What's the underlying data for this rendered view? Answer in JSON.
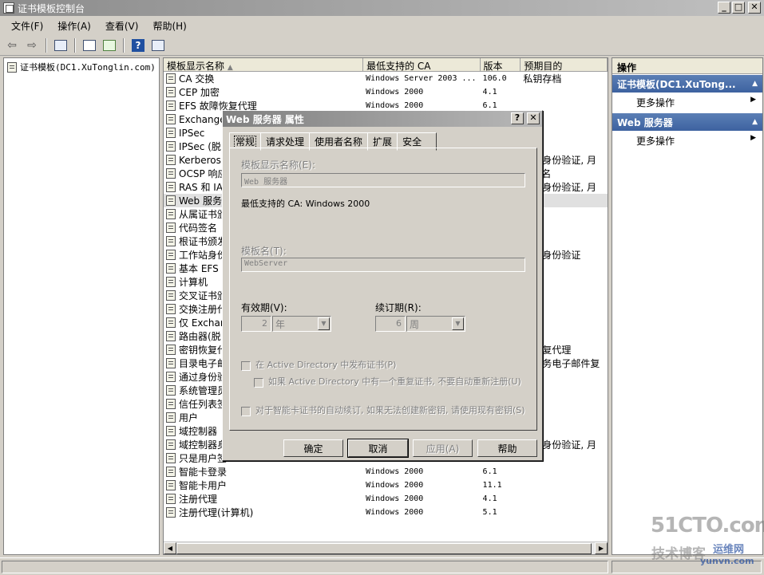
{
  "window": {
    "title": "证书模板控制台"
  },
  "menu": [
    "文件(F)",
    "操作(A)",
    "查看(V)",
    "帮助(H)"
  ],
  "tree": {
    "root": "证书模板(DC1.XuTonglin.com)"
  },
  "list": {
    "headers": {
      "name": "模板显示名称",
      "ca": "最低支持的 CA",
      "version": "版本",
      "purpose": "预期目的"
    },
    "rows": [
      {
        "name": "CA 交换",
        "ca": "Windows Server 2003 ...",
        "version": "106.0",
        "purpose": "私钥存档"
      },
      {
        "name": "CEP 加密",
        "ca": "Windows 2000",
        "version": "4.1",
        "purpose": ""
      },
      {
        "name": "EFS 故障恢复代理",
        "ca": "Windows 2000",
        "version": "6.1",
        "purpose": ""
      },
      {
        "name": "Exchange",
        "ca": "",
        "version": "",
        "purpose": ""
      },
      {
        "name": "IPSec",
        "ca": "",
        "version": "",
        "purpose": ""
      },
      {
        "name": "IPSec (脱",
        "ca": "",
        "version": "",
        "purpose": ""
      },
      {
        "name": "Kerberos",
        "ca": "",
        "version": "",
        "purpose": "户端身份验证, 月"
      },
      {
        "name": "OCSP 响应",
        "ca": "",
        "version": "",
        "purpose": "P 签名"
      },
      {
        "name": "RAS 和 IA",
        "ca": "",
        "version": "",
        "purpose": "户端身份验证, 月"
      },
      {
        "name": "Web 服务器",
        "ca": "",
        "version": "",
        "purpose": "",
        "selected": true
      },
      {
        "name": "从属证书颁",
        "ca": "",
        "version": "",
        "purpose": ""
      },
      {
        "name": "代码签名",
        "ca": "",
        "version": "",
        "purpose": ""
      },
      {
        "name": "根证书颁发",
        "ca": "",
        "version": "",
        "purpose": ""
      },
      {
        "name": "工作站身份",
        "ca": "",
        "version": "",
        "purpose": "户端身份验证"
      },
      {
        "name": "基本 EFS",
        "ca": "",
        "version": "",
        "purpose": ""
      },
      {
        "name": "计算机",
        "ca": "",
        "version": "",
        "purpose": ""
      },
      {
        "name": "交叉证书颁",
        "ca": "",
        "version": "",
        "purpose": ""
      },
      {
        "name": "交换注册代",
        "ca": "",
        "version": "",
        "purpose": ""
      },
      {
        "name": "仅 Exchan",
        "ca": "",
        "version": "",
        "purpose": ""
      },
      {
        "name": "路由器(脱",
        "ca": "",
        "version": "",
        "purpose": ""
      },
      {
        "name": "密钥恢复代",
        "ca": "",
        "version": "",
        "purpose": "钥恢复代理"
      },
      {
        "name": "目录电子邮",
        "ca": "",
        "version": "",
        "purpose": "录服务电子邮件复"
      },
      {
        "name": "通过身份验",
        "ca": "",
        "version": "",
        "purpose": ""
      },
      {
        "name": "系统管理员",
        "ca": "",
        "version": "",
        "purpose": ""
      },
      {
        "name": "信任列表签",
        "ca": "",
        "version": "",
        "purpose": ""
      },
      {
        "name": "用户",
        "ca": "",
        "version": "",
        "purpose": ""
      },
      {
        "name": "域控制器",
        "ca": "",
        "version": "",
        "purpose": ""
      },
      {
        "name": "域控制器身",
        "ca": "",
        "version": "",
        "purpose": "户端身份验证, 月"
      },
      {
        "name": "只是用户签",
        "ca": "",
        "version": "",
        "purpose": ""
      },
      {
        "name": "智能卡登录",
        "ca": "Windows 2000",
        "version": "6.1",
        "purpose": ""
      },
      {
        "name": "智能卡用户",
        "ca": "Windows 2000",
        "version": "11.1",
        "purpose": ""
      },
      {
        "name": "注册代理",
        "ca": "Windows 2000",
        "version": "4.1",
        "purpose": ""
      },
      {
        "name": "注册代理(计算机)",
        "ca": "Windows 2000",
        "version": "5.1",
        "purpose": ""
      }
    ]
  },
  "actions": {
    "title": "操作",
    "sections": [
      {
        "label": "证书模板(DC1.XuTong...",
        "item": "更多操作"
      },
      {
        "label": "Web 服务器",
        "item": "更多操作"
      }
    ]
  },
  "dialog": {
    "title": "Web 服务器 属性",
    "tabs": [
      "常规",
      "请求处理",
      "使用者名称",
      "扩展",
      "安全"
    ],
    "display_name_label": "模板显示名称(E):",
    "display_name_value": "Web 服务器",
    "min_ca_text": "最低支持的 CA:  Windows 2000",
    "template_name_label": "模板名(T):",
    "template_name_value": "WebServer",
    "validity_label": "有效期(V):",
    "validity_value": "2",
    "validity_unit": "年",
    "renewal_label": "续订期(R):",
    "renewal_value": "6",
    "renewal_unit": "周",
    "chk_publish": "在 Active Directory 中发布证书(P)",
    "chk_no_reenroll": "如果 Active Directory 中有一个重复证书, 不要自动重新注册(U)",
    "chk_smartcard": "对于智能卡证书的自动续订, 如果无法创建新密钥, 请使用现有密钥(S)",
    "buttons": {
      "ok": "确定",
      "cancel": "取消",
      "apply": "应用(A)",
      "help": "帮助"
    }
  },
  "watermark": {
    "line1": "51CTO.com",
    "line2": "技术博客",
    "line3": "运维网",
    "line4": "yunvn.com"
  }
}
